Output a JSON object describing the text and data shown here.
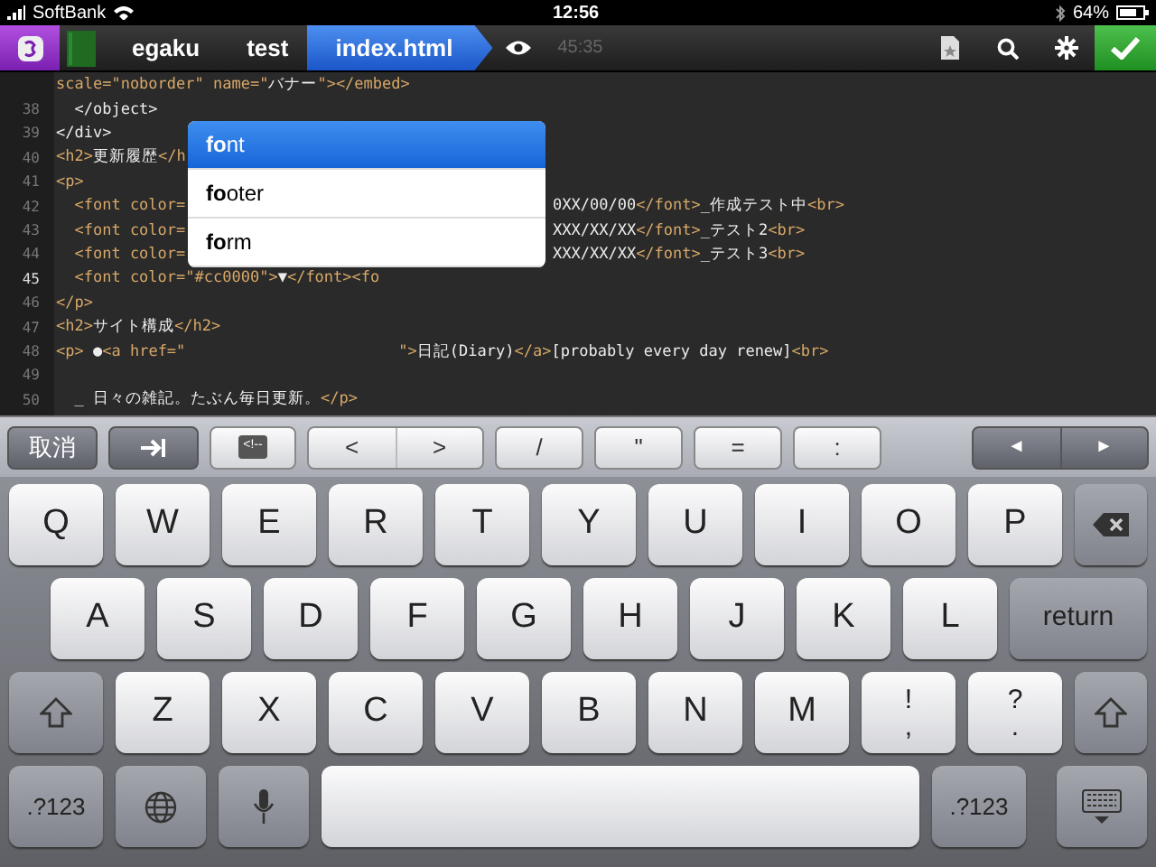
{
  "status_bar": {
    "carrier": "SoftBank",
    "time": "12:56",
    "battery": "64%"
  },
  "toolbar": {
    "breadcrumbs": [
      {
        "label": "egaku",
        "selected": false
      },
      {
        "label": "test",
        "selected": false
      },
      {
        "label": "index.html",
        "selected": true
      }
    ],
    "timer": "45:35"
  },
  "editor": {
    "lines": [
      {
        "code": [
          {
            "kind": "tag",
            "text": "scale=\"noborder\" name=\""
          },
          {
            "kind": "text",
            "text": "バナー"
          },
          {
            "kind": "tag",
            "text": "\"></embed>"
          }
        ]
      },
      {
        "number": "38",
        "current": false,
        "code": [
          {
            "kind": "text",
            "text": "  </object>"
          }
        ]
      },
      {
        "number": "39",
        "current": false,
        "code": [
          {
            "kind": "text",
            "text": "</div>"
          }
        ]
      },
      {
        "number": "40",
        "current": false,
        "code": [
          {
            "kind": "tag",
            "text": "<h2>"
          },
          {
            "kind": "text",
            "text": "更新履歴"
          },
          {
            "kind": "tag",
            "text": "</h"
          }
        ]
      },
      {
        "number": "41",
        "current": false,
        "code": [
          {
            "kind": "tag",
            "text": "<p>"
          }
        ]
      },
      {
        "number": "42",
        "current": false,
        "code": [
          {
            "kind": "tag",
            "text": "  <font color="
          }
        ],
        "code_after": [
          {
            "kind": "text",
            "text": "0XX/00/00"
          },
          {
            "kind": "tag",
            "text": "</font>"
          },
          {
            "kind": "text",
            "text": "_作成テスト中"
          },
          {
            "kind": "tag",
            "text": "<br>"
          }
        ]
      },
      {
        "number": "43",
        "current": false,
        "code": [
          {
            "kind": "tag",
            "text": "  <font color="
          }
        ],
        "code_after": [
          {
            "kind": "text",
            "text": "XXX/XX/XX"
          },
          {
            "kind": "tag",
            "text": "</font>"
          },
          {
            "kind": "text",
            "text": "_テスト2"
          },
          {
            "kind": "tag",
            "text": "<br>"
          }
        ]
      },
      {
        "number": "44",
        "current": false,
        "code": [
          {
            "kind": "tag",
            "text": "  <font color="
          }
        ],
        "code_after": [
          {
            "kind": "text",
            "text": "XXX/XX/XX"
          },
          {
            "kind": "tag",
            "text": "</font>"
          },
          {
            "kind": "text",
            "text": "_テスト3"
          },
          {
            "kind": "tag",
            "text": "<br>"
          }
        ]
      },
      {
        "number": "45",
        "current": true,
        "code": [
          {
            "kind": "tag",
            "text": "  <font color=\"#cc0000\">"
          },
          {
            "kind": "text",
            "text": "▼"
          },
          {
            "kind": "tag",
            "text": "</font><fo"
          }
        ]
      },
      {
        "number": "46",
        "current": false,
        "code": [
          {
            "kind": "tag",
            "text": "</p>"
          }
        ]
      },
      {
        "number": "47",
        "current": false,
        "code": [
          {
            "kind": "tag",
            "text": "<h2>"
          },
          {
            "kind": "text",
            "text": "サイト構成"
          },
          {
            "kind": "tag",
            "text": "</h2>"
          }
        ]
      },
      {
        "number": "48",
        "current": false,
        "code": [
          {
            "kind": "tag",
            "text": "<p>"
          },
          {
            "kind": "text",
            "text": " ●"
          },
          {
            "kind": "tag",
            "text": "<a href=\""
          }
        ],
        "code_tail": [
          {
            "kind": "tag",
            "text": "\">"
          },
          {
            "kind": "text",
            "text": "日記(Diary)"
          },
          {
            "kind": "tag",
            "text": "</a>"
          },
          {
            "kind": "text",
            "text": "[probably every day renew]"
          },
          {
            "kind": "tag",
            "text": "<br>"
          }
        ]
      },
      {
        "number": "49",
        "current": false
      },
      {
        "number": "50",
        "current": false,
        "code": [
          {
            "kind": "text",
            "text": "  _ 日々の雑記。たぶん毎日更新。"
          },
          {
            "kind": "tag",
            "text": "</p>"
          }
        ]
      }
    ]
  },
  "completions": [
    {
      "label": "**fo**nt",
      "selected": true
    },
    {
      "label": "**fo**oter",
      "selected": false
    },
    {
      "label": "**fo**rm",
      "selected": false
    }
  ],
  "accessory_bar": [
    {
      "kind": "cancel",
      "label": "取消"
    },
    {
      "kind": "tab"
    },
    {
      "kind": "comment",
      "label": "<!--"
    },
    {
      "kind": "pair",
      "labels": [
        "<",
        ">"
      ]
    },
    {
      "kind": "key",
      "label": "/"
    },
    {
      "kind": "key",
      "label": "\""
    },
    {
      "kind": "key",
      "label": "="
    },
    {
      "kind": "key",
      "label": ":"
    },
    {
      "kind": "arrows",
      "labels": [
        "◄",
        "►"
      ]
    }
  ],
  "keyboard": {
    "rows": [
      [
        {
          "kind": "letter",
          "label": "Q"
        },
        {
          "kind": "letter",
          "label": "W"
        },
        {
          "kind": "letter",
          "label": "E"
        },
        {
          "kind": "letter",
          "label": "R"
        },
        {
          "kind": "letter",
          "label": "T"
        },
        {
          "kind": "letter",
          "label": "Y"
        },
        {
          "kind": "letter",
          "label": "U"
        },
        {
          "kind": "letter",
          "label": "I"
        },
        {
          "kind": "letter",
          "label": "O"
        },
        {
          "kind": "letter",
          "label": "P"
        },
        {
          "kind": "delete"
        }
      ],
      [
        {
          "kind": "letter",
          "label": "A"
        },
        {
          "kind": "letter",
          "label": "S"
        },
        {
          "kind": "letter",
          "label": "D"
        },
        {
          "kind": "letter",
          "label": "F"
        },
        {
          "kind": "letter",
          "label": "G"
        },
        {
          "kind": "letter",
          "label": "H"
        },
        {
          "kind": "letter",
          "label": "J"
        },
        {
          "kind": "letter",
          "label": "K"
        },
        {
          "kind": "letter",
          "label": "L"
        },
        {
          "kind": "return",
          "label": "return"
        }
      ],
      [
        {
          "kind": "shift"
        },
        {
          "kind": "letter",
          "label": "Z"
        },
        {
          "kind": "letter",
          "label": "X"
        },
        {
          "kind": "letter",
          "label": "C"
        },
        {
          "kind": "letter",
          "label": "V"
        },
        {
          "kind": "letter",
          "label": "B"
        },
        {
          "kind": "letter",
          "label": "N"
        },
        {
          "kind": "letter",
          "label": "M"
        },
        {
          "kind": "double",
          "label": "!",
          "label_bottom": ","
        },
        {
          "kind": "double",
          "label": "?",
          "label_bottom": "."
        },
        {
          "kind": "shift"
        }
      ],
      [
        {
          "kind": "mode",
          "label": ".?123"
        },
        {
          "kind": "globe"
        },
        {
          "kind": "mic"
        },
        {
          "kind": "space"
        },
        {
          "kind": "mode",
          "label": ".?123"
        },
        {
          "kind": "hide"
        }
      ]
    ]
  }
}
